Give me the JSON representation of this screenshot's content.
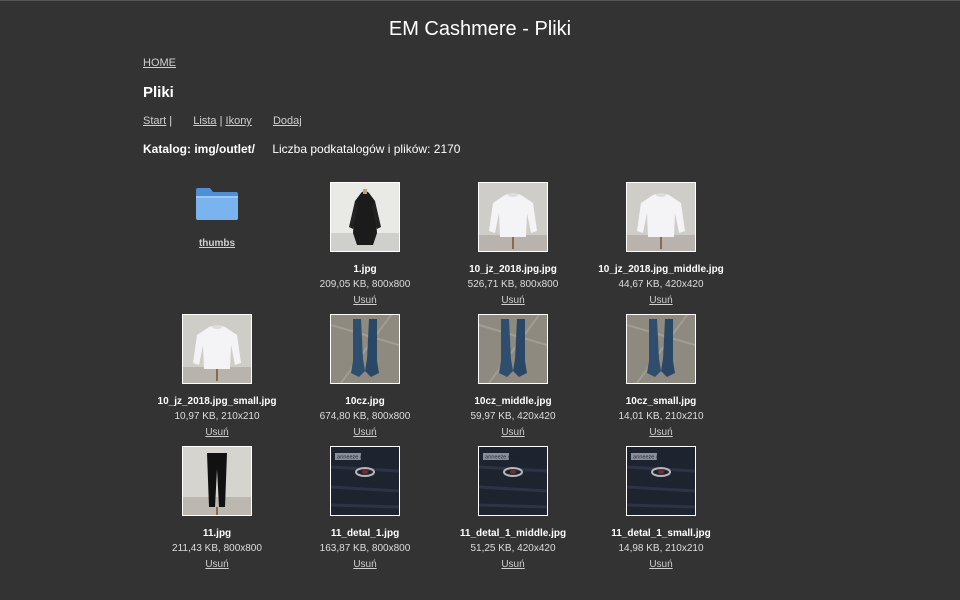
{
  "site_title": "EM Cashmere - Pliki",
  "breadcrumb": {
    "home": "HOME"
  },
  "page_heading": "Pliki",
  "toolbar": {
    "start": "Start",
    "sep1": "|",
    "list": "Lista",
    "sep2": "|",
    "icons": "Ikony",
    "add": "Dodaj"
  },
  "catalog": {
    "label": "Katalog: img/outlet/",
    "count_text": "Liczba podkatalogów i plików: 2170"
  },
  "folder": {
    "name": "thumbs",
    "icon": "folder-icon"
  },
  "files": [
    {
      "name": "1.jpg",
      "info": "209,05 KB, 800x800",
      "delete": "Usuń",
      "kind": "coat"
    },
    {
      "name": "10_jz_2018.jpg.jpg",
      "info": "526,71 KB, 800x800",
      "delete": "Usuń",
      "kind": "sweater"
    },
    {
      "name": "10_jz_2018.jpg_middle.jpg",
      "info": "44,67 KB, 420x420",
      "delete": "Usuń",
      "kind": "sweater"
    },
    {
      "name": "10_jz_2018.jpg_small.jpg",
      "info": "10,97 KB, 210x210",
      "delete": "Usuń",
      "kind": "sweater"
    },
    {
      "name": "10cz.jpg",
      "info": "674,80 KB, 800x800",
      "delete": "Usuń",
      "kind": "gloves"
    },
    {
      "name": "10cz_middle.jpg",
      "info": "59,97 KB, 420x420",
      "delete": "Usuń",
      "kind": "gloves"
    },
    {
      "name": "10cz_small.jpg",
      "info": "14,01 KB, 210x210",
      "delete": "Usuń",
      "kind": "gloves"
    },
    {
      "name": "11.jpg",
      "info": "211,43 KB, 800x800",
      "delete": "Usuń",
      "kind": "pants"
    },
    {
      "name": "11_detal_1.jpg",
      "info": "163,87 KB, 800x800",
      "delete": "Usuń",
      "kind": "detail"
    },
    {
      "name": "11_detal_1_middle.jpg",
      "info": "51,25 KB, 420x420",
      "delete": "Usuń",
      "kind": "detail"
    },
    {
      "name": "11_detal_1_small.jpg",
      "info": "14,98 KB, 210x210",
      "delete": "Usuń",
      "kind": "detail"
    }
  ],
  "label_text": "anneeze görtz",
  "colors": {
    "background": "#333333",
    "text": "#ffffff",
    "link": "#cfcfcf",
    "folder": "#6fa8e6"
  }
}
